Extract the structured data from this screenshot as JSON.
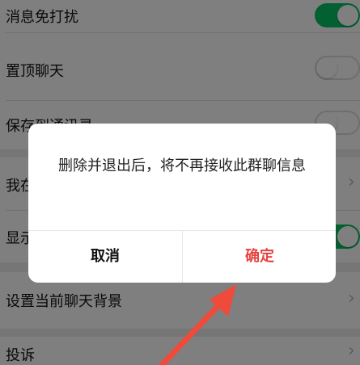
{
  "settings": {
    "rows": [
      {
        "label": "消息免打扰",
        "control": "toggle",
        "state": "on"
      },
      {
        "label": "置顶聊天",
        "control": "toggle",
        "state": "off"
      },
      {
        "label": "保存到通讯录",
        "control": "toggle",
        "state": "off"
      },
      {
        "label": "我在本群的昵称",
        "control": "chevron"
      },
      {
        "label": "显示群成员昵称",
        "control": "toggle",
        "state": "on"
      },
      {
        "label": "设置当前聊天背景",
        "control": "chevron"
      },
      {
        "label": "投诉",
        "control": "chevron"
      }
    ]
  },
  "dialog": {
    "message": "删除并退出后，将不再接收此群聊信息",
    "cancel_label": "取消",
    "confirm_label": "确定"
  },
  "colors": {
    "toggle_on": "#07c160",
    "confirm": "#e64340",
    "annotation_arrow": "#f04a3a"
  },
  "icons": {
    "chevron": "chevron-right-icon",
    "annotation": "red-arrow-icon"
  }
}
